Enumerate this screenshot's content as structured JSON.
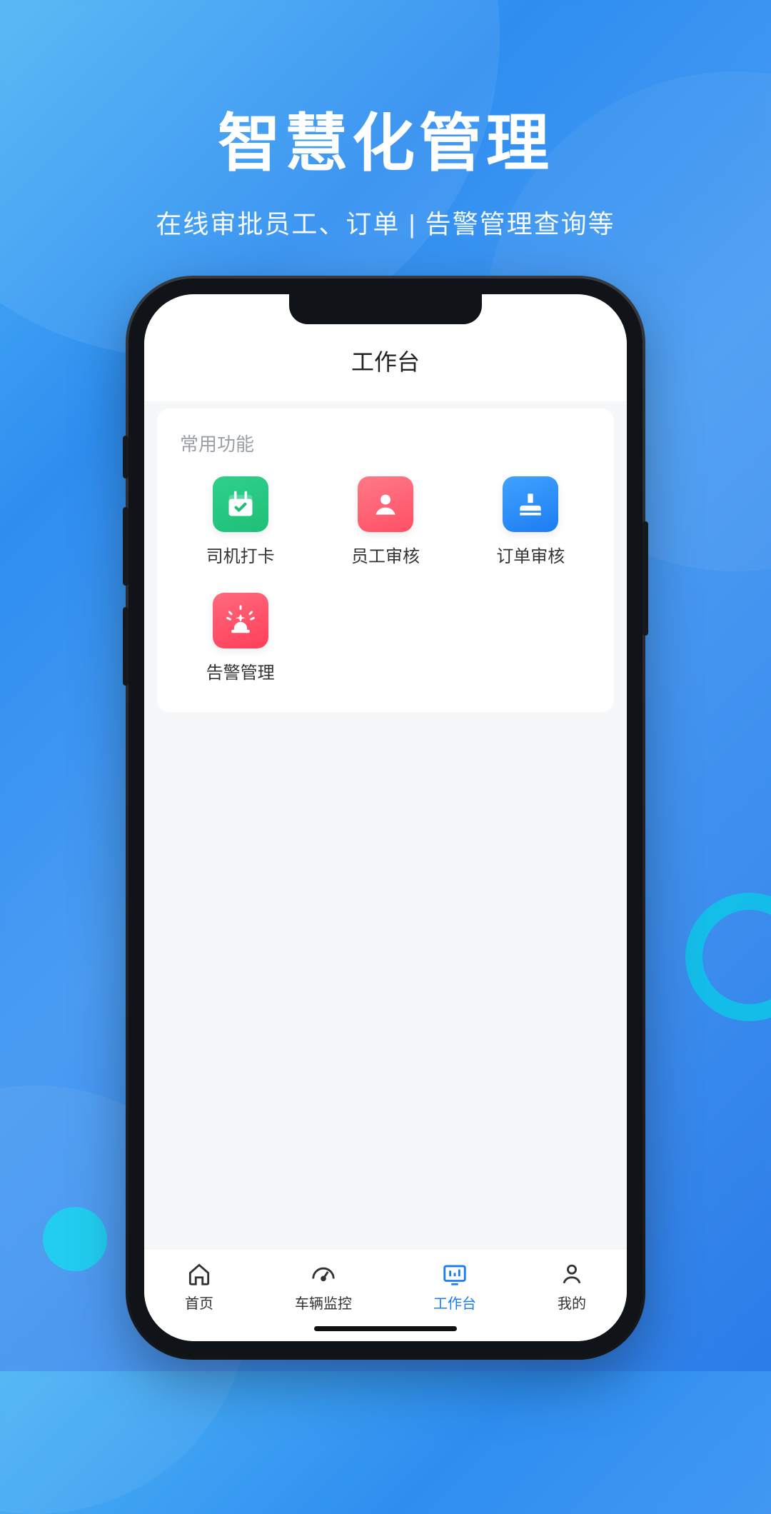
{
  "heading": {
    "title": "智慧化管理",
    "subtitle": "在线审批员工、订单 | 告警管理查询等"
  },
  "appHeader": {
    "title": "工作台"
  },
  "section": {
    "label": "常用功能"
  },
  "items": [
    {
      "label": "司机打卡"
    },
    {
      "label": "员工审核"
    },
    {
      "label": "订单审核"
    },
    {
      "label": "告警管理"
    }
  ],
  "nav": [
    {
      "label": "首页"
    },
    {
      "label": "车辆监控"
    },
    {
      "label": "工作台"
    },
    {
      "label": "我的"
    }
  ],
  "colors": {
    "accent": "#1e7cf2",
    "tileGreen": "#1fbf78",
    "tilePink": "#ff4f66",
    "tileBlue": "#1e7cf2",
    "tileRed": "#ff3e5c"
  }
}
